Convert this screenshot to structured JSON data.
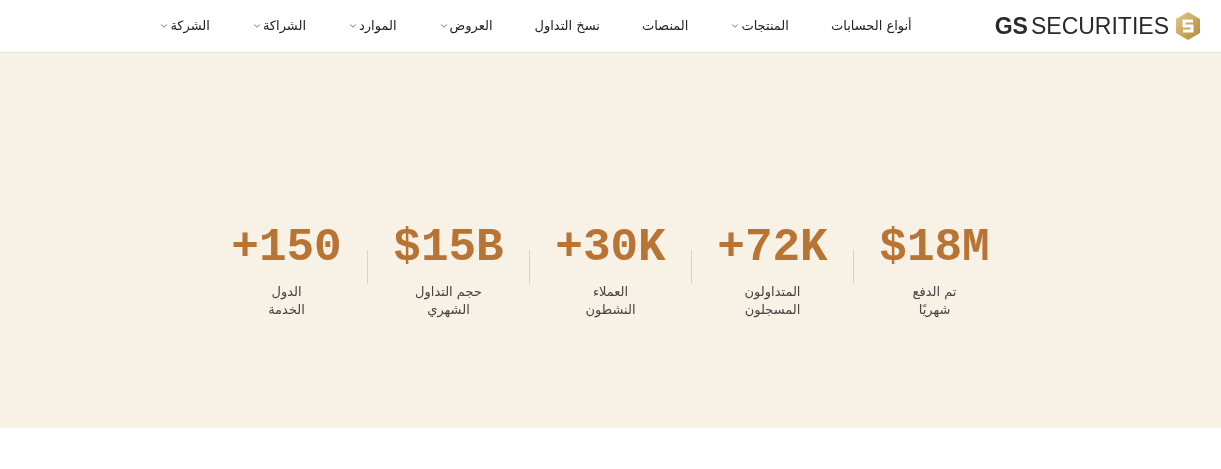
{
  "header": {
    "logo": {
      "bold": "GS",
      "text": "SECURITIES"
    },
    "nav": [
      {
        "label": "أنواع الحسابات",
        "has_dropdown": false
      },
      {
        "label": "المنتجات",
        "has_dropdown": true
      },
      {
        "label": "المنصات",
        "has_dropdown": false
      },
      {
        "label": "نسخ التداول",
        "has_dropdown": false
      },
      {
        "label": "العروض",
        "has_dropdown": true
      },
      {
        "label": "الموارد",
        "has_dropdown": true
      },
      {
        "label": "الشراكة",
        "has_dropdown": true
      },
      {
        "label": "الشركة",
        "has_dropdown": true
      }
    ]
  },
  "stats": [
    {
      "value": "$18M",
      "lines": [
        "تم الدفع",
        "شهريًا"
      ]
    },
    {
      "value": "+72K",
      "lines": [
        "المتداولون",
        "المسجلون"
      ]
    },
    {
      "value": "+30K",
      "lines": [
        "العملاء",
        "النشطون"
      ]
    },
    {
      "value": "$15B",
      "lines": [
        "حجم التداول",
        "الشهري"
      ]
    },
    {
      "value": "+150",
      "lines": [
        "الدول",
        "الخدمة"
      ]
    }
  ]
}
